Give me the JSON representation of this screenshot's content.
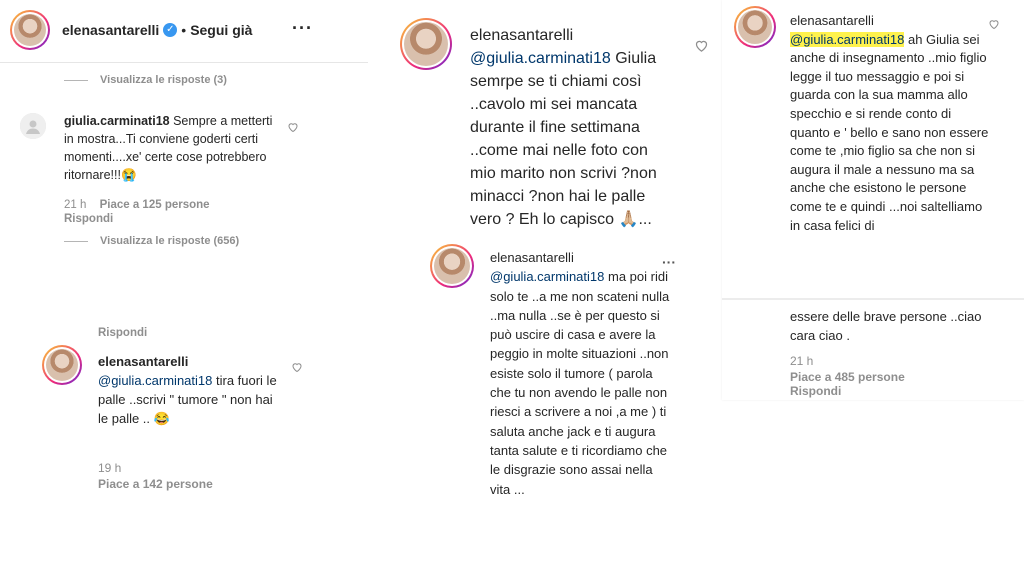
{
  "panel_left": {
    "header": {
      "username": "elenasantarelli",
      "separator": "•",
      "follow_label": "Segui già",
      "more_label": "···"
    },
    "view_replies_1": "Visualizza le risposte (3)",
    "comment": {
      "username": "giulia.carminati18",
      "text": "Sempre a metterti in mostra...Ti conviene goderti certi momenti....xe' certe cose potrebbero ritornare!!!😭",
      "time": "21 h",
      "likes": "Piace a 125 persone",
      "reply": "Rispondi"
    },
    "view_replies_2": "Visualizza le risposte (656)",
    "reply_label_top": "Rispondi",
    "reply": {
      "username": "elenasantarelli",
      "mention": "@giulia.carminati18",
      "text": "tira fuori le palle ..scrivi \" tumore \" non hai le palle .. 😂",
      "time": "19 h",
      "likes": "Piace a 142 persone"
    }
  },
  "panel_middle_top": {
    "username": "elenasantarelli",
    "mention": "@giulia.carminati18",
    "text": "Giulia semrpe se ti chiami così ..cavolo mi sei mancata durante il fine settimana ..come mai nelle foto con mio marito non scrivi ?non minacci ?non hai le palle vero ? Eh lo capisco 🙏🏼..."
  },
  "panel_middle_bottom": {
    "username": "elenasantarelli",
    "mention": "@giulia.carminati18",
    "more_label": "···",
    "text": "ma poi ridi solo te ..a me non scateni nulla ..ma nulla ..se è per questo si può uscire di casa e avere la peggio in molte situazioni ..non esiste solo il tumore ( parola che tu non avendo le palle non riesci a scrivere a noi ,a me ) ti saluta anche jack e ti augura tanta salute e ti ricordiamo che le disgrazie sono assai nella vita ..."
  },
  "panel_right": {
    "username": "elenasantarelli",
    "mention": "@giulia.carminati18",
    "text_a": "ah Giulia sei anche di insegnamento ..mio figlio legge il tuo messaggio e poi si guarda con la sua mamma allo specchio e si rende conto di quanto e ' bello e sano non essere come te ,mio figlio sa che non si augura il male a nessuno ma sa anche che esistono le persone come te e quindi ...noi saltelliamo in casa felici di",
    "text_b": "essere delle brave persone ..ciao cara ciao .",
    "time": "21 h",
    "likes": "Piace a 485 persone",
    "reply": "Rispondi"
  },
  "colors": {
    "username": "#262626",
    "mention": "#00376b",
    "meta": "#8e8e8e",
    "verified": "#3897f0",
    "highlight": "#fff24d"
  }
}
